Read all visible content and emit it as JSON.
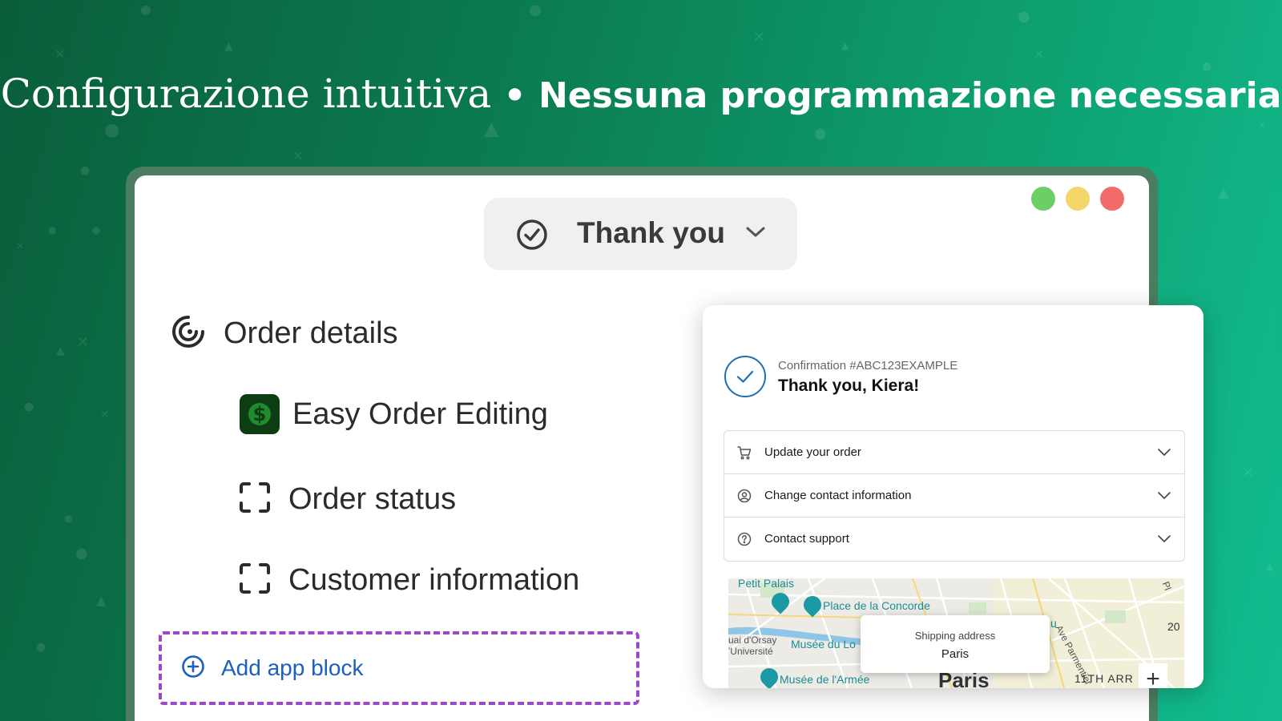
{
  "headline": {
    "light": "Configurazione intuitiva",
    "separator": " • ",
    "bold": "Nessuna programmazione necessaria"
  },
  "window": {
    "traffic_lights": [
      "#6ccf64",
      "#f5d66b",
      "#f26b6b"
    ]
  },
  "page_selector": {
    "label": "Thank you",
    "icon": "check-circle-icon"
  },
  "editor": {
    "section_title": "Order details",
    "items": [
      {
        "label": "Easy Order Editing",
        "icon": "dollar-app-icon"
      },
      {
        "label": "Order status",
        "icon": "block-placeholder-icon"
      },
      {
        "label": "Customer information",
        "icon": "block-placeholder-icon"
      }
    ],
    "add_block_label": "Add app block"
  },
  "preview": {
    "confirmation": "Confirmation #ABC123EXAMPLE",
    "thanks": "Thank you, Kiera!",
    "accordion": [
      {
        "label": "Update your order",
        "icon": "cart-icon"
      },
      {
        "label": "Change contact information",
        "icon": "user-circle-icon"
      },
      {
        "label": "Contact support",
        "icon": "question-circle-icon"
      }
    ],
    "map": {
      "labels": {
        "petit_palais": "Petit Palais",
        "concorde": "Place de la Concorde",
        "orsay": "uai d'Orsay",
        "universite": "'Université",
        "musee_louvre": "Musée du Lo",
        "armee": "Musée de l'Armée",
        "parmentier": "Ave Parmentier",
        "city": "Paris",
        "arr": "11TH ARR",
        "arr_num": "20",
        "u": "u",
        "pl": "Pl"
      },
      "popup_title": "Shipping address",
      "popup_value": "Paris",
      "zoom_label": "+"
    }
  }
}
